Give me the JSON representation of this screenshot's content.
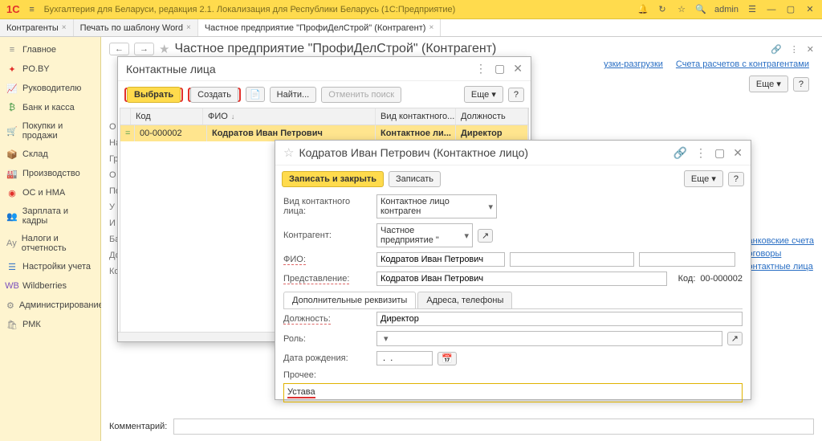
{
  "titlebar": {
    "logo": "1C",
    "app_title": "Бухгалтерия для Беларуси, редакция 2.1. Локализация для Республики Беларусь  (1С:Предприятие)",
    "user": "admin"
  },
  "doctabs": [
    {
      "label": "Контрагенты",
      "close": "×"
    },
    {
      "label": "Печать по шаблону Word",
      "close": "×"
    },
    {
      "label": "Частное предприятие \"ПрофиДелСтрой\" (Контрагент)",
      "close": "×",
      "active": true
    }
  ],
  "sidebar": {
    "items": [
      {
        "label": "Главное",
        "icon": "≡",
        "color": "gray"
      },
      {
        "label": "PO.BY",
        "icon": "✦",
        "color": "red"
      },
      {
        "label": "Руководителю",
        "icon": "📈",
        "color": "blue"
      },
      {
        "label": "Банк и касса",
        "icon": "₿",
        "color": "green"
      },
      {
        "label": "Покупки и продажи",
        "icon": "🛒",
        "color": "teal"
      },
      {
        "label": "Склад",
        "icon": "📦",
        "color": "teal"
      },
      {
        "label": "Производство",
        "icon": "🏭",
        "color": "gray"
      },
      {
        "label": "ОС и НМА",
        "icon": "◉",
        "color": "red"
      },
      {
        "label": "Зарплата и кадры",
        "icon": "👥",
        "color": "blue"
      },
      {
        "label": "Налоги и отчетность",
        "icon": "Ау",
        "color": "gray"
      },
      {
        "label": "Настройки учета",
        "icon": "☰",
        "color": "blue"
      },
      {
        "label": "Wildberries",
        "icon": "WB",
        "color": "purple"
      },
      {
        "label": "Администрирование",
        "icon": "⚙",
        "color": "gray"
      },
      {
        "label": "РМК",
        "icon": "🛍",
        "color": "gray"
      }
    ]
  },
  "counterparty": {
    "title": "Частное предприятие \"ПрофиДелСтрой\" (Контрагент)",
    "links": {
      "load": "узки-разгрузки",
      "accounts": "Счета расчетов с контрагентами"
    },
    "more": "Еще",
    "help": "?",
    "left_labels": [
      "О",
      "Наи",
      "Гру",
      "О",
      "По",
      "У",
      "И",
      "Ба",
      "До",
      "Ко"
    ],
    "right_links": [
      "анковские счета",
      "оговоры",
      "онтактные лица"
    ],
    "comment_label": "Комментарий:"
  },
  "contacts_window": {
    "title": "Контактные лица",
    "buttons": {
      "select": "Выбрать",
      "create": "Создать",
      "find": "Найти...",
      "cancel_find": "Отменить поиск",
      "more": "Еще",
      "help": "?"
    },
    "columns": {
      "code": "Код",
      "fio": "ФИО",
      "type": "Вид контактного...",
      "position": "Должность"
    },
    "rows": [
      {
        "marker": "=",
        "code": "00-000002",
        "fio": "Кодратов Иван Петрович",
        "type": "Контактное ли...",
        "position": "Директор"
      }
    ]
  },
  "person_window": {
    "title": "Кодратов Иван Петрович (Контактное лицо)",
    "buttons": {
      "save_close": "Записать и закрыть",
      "save": "Записать",
      "more": "Еще",
      "help": "?"
    },
    "fields": {
      "type_label": "Вид контактного лица:",
      "type_value": "Контактное лицо контраген",
      "counterparty_label": "Контрагент:",
      "counterparty_value": "Частное предприятие \"",
      "fio_label": "ФИО:",
      "fio_value": "Кодратов Иван Петрович",
      "repr_label": "Представление:",
      "repr_value": "Кодратов Иван Петрович",
      "code_label": "Код:",
      "code_value": "00-000002",
      "position_label": "Должность:",
      "position_value": "Директор",
      "role_label": "Роль:",
      "role_value": "",
      "birth_label": "Дата рождения:",
      "birth_value": " .  .    ",
      "other_label": "Прочее:",
      "other_value": "Устава"
    },
    "tabs": {
      "extra": "Дополнительные реквизиты",
      "addr": "Адреса, телефоны"
    }
  }
}
